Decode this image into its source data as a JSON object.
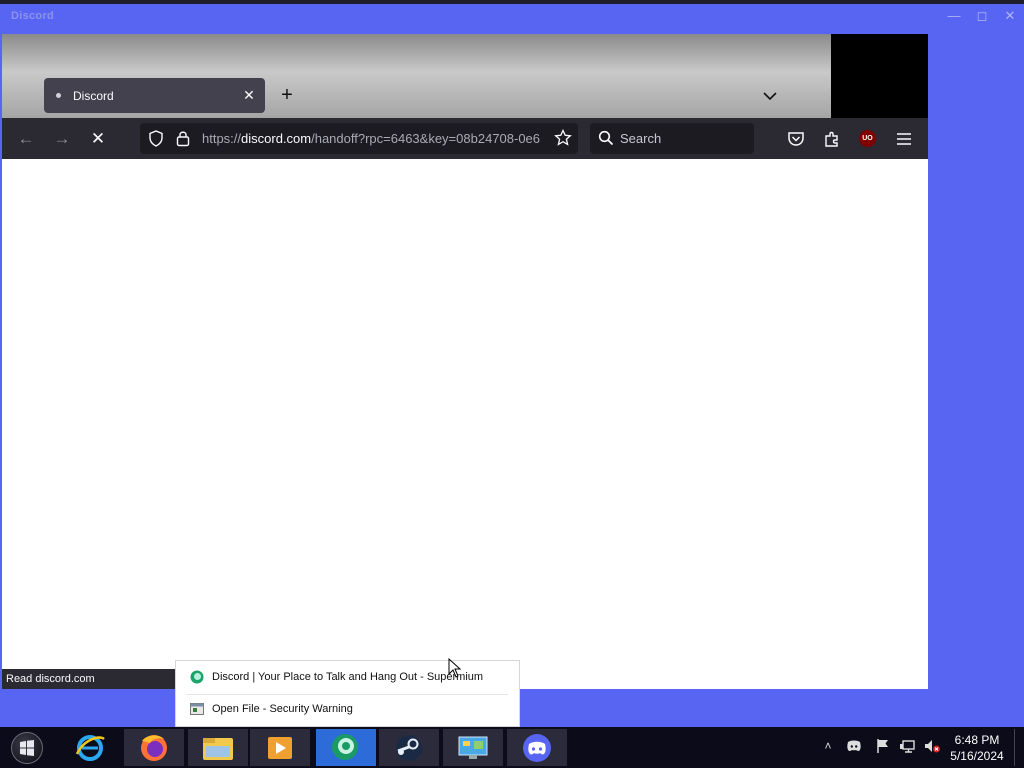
{
  "window": {
    "title": "Discord"
  },
  "browser": {
    "tab": {
      "title": "Discord"
    },
    "url": {
      "scheme": "https://",
      "host": "discord.com",
      "path": "/handoff?rpc=6463&key=08b24708-0e6"
    },
    "search": {
      "placeholder": "Search"
    },
    "status": "Read discord.com"
  },
  "jumplist": {
    "items": [
      {
        "label": "Discord | Your Place to Talk and Hang Out - Supermium"
      },
      {
        "label": "Open File - Security Warning"
      }
    ]
  },
  "taskbar": {
    "apps": [
      "internet-explorer",
      "firefox",
      "file-explorer",
      "media-player",
      "supermium",
      "steam",
      "control-panel",
      "discord"
    ],
    "clock": {
      "time": "6:48 PM",
      "date": "5/16/2024"
    }
  },
  "colors": {
    "accent": "#5865f2",
    "taskbar": "#0b0b1a",
    "active_app": "#2d6bd8"
  }
}
